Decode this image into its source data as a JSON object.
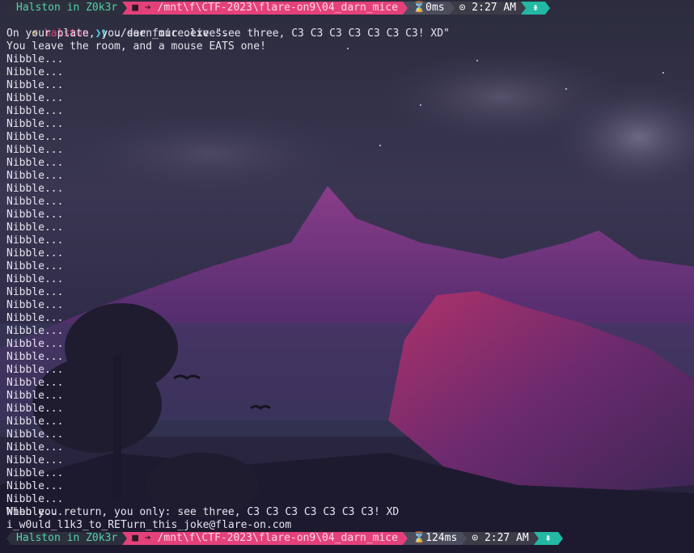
{
  "prompt_bar_top": {
    "user_segment": "Halston in Z0k3r",
    "dir_segment": "/mnt\\f\\CTF-2023\\flare-on9\\04_darn_mice",
    "duration": "0ms",
    "clock": "2:27 AM"
  },
  "command_line": {
    "user": "halston",
    "chevrons": "❯❯",
    "command": "./darn_mice.exe \"see three, C3 C3 C3 C3 C3 C3 C3! XD\""
  },
  "output": {
    "plate_line": "On your plate, you see four olives.",
    "leave_line": "You leave the room, and a mouse EATS one!",
    "nibble_lines": [
      "Nibble...",
      "Nibble...",
      "Nibble...",
      "Nibble...",
      "Nibble...",
      "Nibble...",
      "Nibble...",
      "Nibble...",
      "Nibble...",
      "Nibble...",
      "Nibble...",
      "Nibble...",
      "Nibble...",
      "Nibble...",
      "Nibble...",
      "Nibble...",
      "Nibble...",
      "Nibble...",
      "Nibble...",
      "Nibble...",
      "Nibble...",
      "Nibble...",
      "Nibble...",
      "Nibble...",
      "Nibble...",
      "Nibble...",
      "Nibble...",
      "Nibble...",
      "Nibble...",
      "Nibble...",
      "Nibble...",
      "Nibble...",
      "Nibble...",
      "Nibble...",
      "Nibble...",
      "Nibble..."
    ],
    "return_line": "When you return, you only: see three, C3 C3 C3 C3 C3 C3 C3! XD",
    "flag_line": "i_w0uld_l1k3_to_RETurn_this_joke@flare-on.com"
  },
  "prompt_bar_bottom": {
    "user_segment": "Halston in Z0k3r",
    "dir_segment": "/mnt\\f\\CTF-2023\\flare-on9\\04_darn_mice",
    "duration": "124ms",
    "clock": "2:27 AM"
  },
  "final_prompt": {
    "user": "halston",
    "chevrons": "❯❯"
  },
  "icons": {
    "left_cap": "triangle-left-icon",
    "folder": "folder-icon",
    "arrow": "arrow-right-icon",
    "hourglass": "hourglass-icon",
    "clock": "clock-icon",
    "git": "git-icon",
    "bolt": "lightning-icon"
  },
  "colors": {
    "user_green": "#4fd4a9",
    "dir_pink": "#e4417a",
    "git_teal": "#22b8a4",
    "prompt_user": "#e4417a",
    "chevrons": "#4ad0f0",
    "bolt": "#f2c94c",
    "text": "#e6e3ee"
  }
}
